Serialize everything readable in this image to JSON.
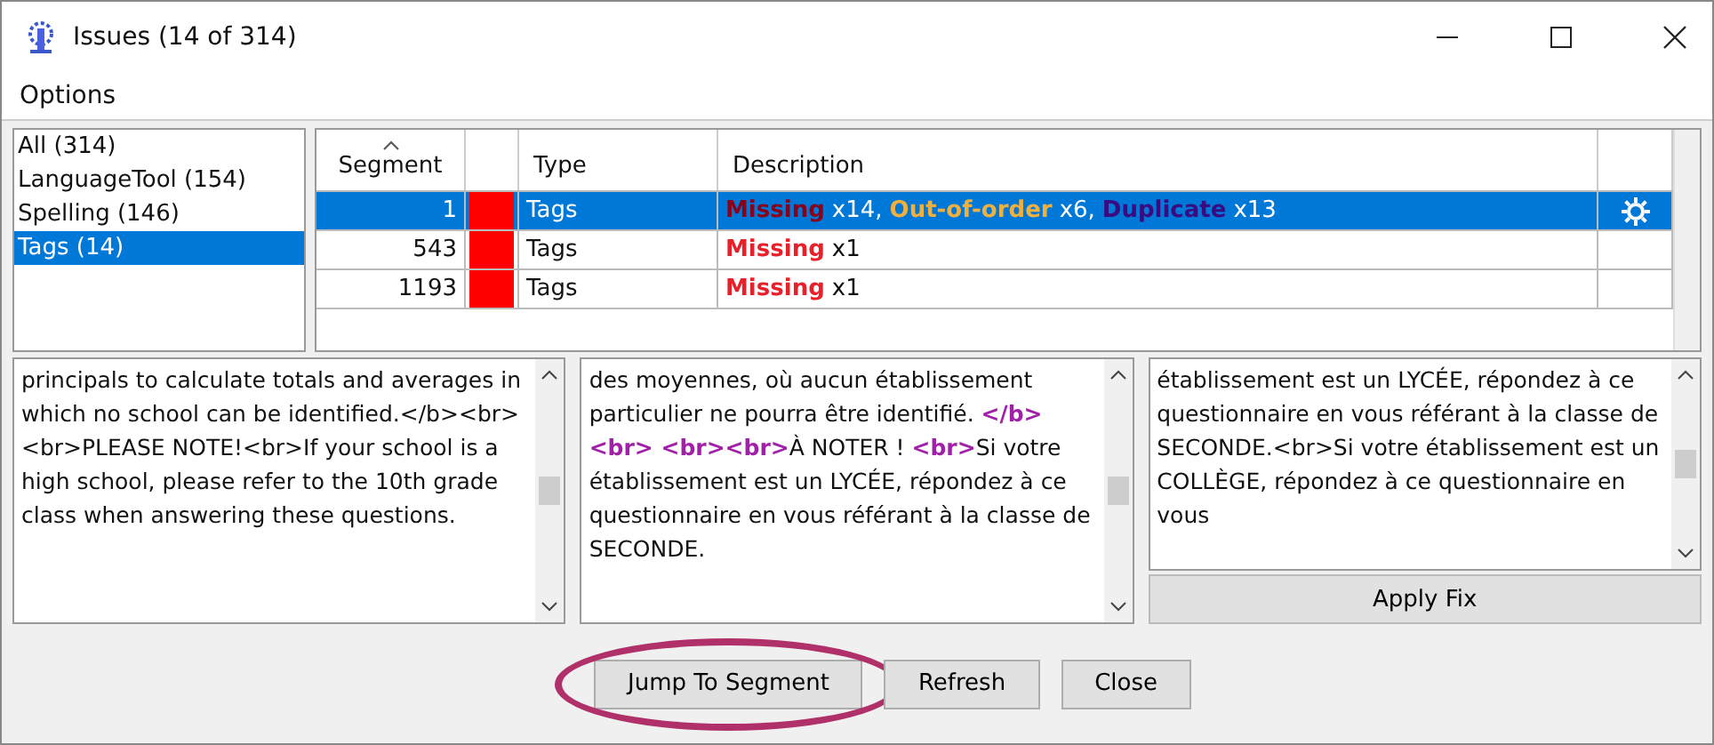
{
  "window": {
    "title": "Issues (14 of 314)"
  },
  "menu": [
    "Options"
  ],
  "categories": [
    {
      "label": "All (314)",
      "selected": false
    },
    {
      "label": "LanguageTool (154)",
      "selected": false
    },
    {
      "label": "Spelling (146)",
      "selected": false
    },
    {
      "label": "Tags (14)",
      "selected": true
    }
  ],
  "table": {
    "columns": [
      {
        "label": "Segment",
        "sorted": true
      },
      {
        "sorted": false
      },
      {
        "label": "Type",
        "sorted": false
      },
      {
        "label": "Description",
        "sorted": false
      }
    ],
    "rows": [
      {
        "segment": "1",
        "color": "#ff0000",
        "type": "Tags",
        "selected": true,
        "fixable": true,
        "description": [
          {
            "label": "Missing",
            "kind": "missing",
            "count": "x14,"
          },
          {
            "label": "Out-of-order",
            "kind": "order",
            "count": "x6,"
          },
          {
            "label": "Duplicate",
            "kind": "duplicate",
            "count": "x13"
          }
        ]
      },
      {
        "segment": "543",
        "color": "#ff0000",
        "type": "Tags",
        "selected": false,
        "fixable": false,
        "description": [
          {
            "label": "Missing",
            "kind": "missing",
            "count": "x1"
          }
        ]
      },
      {
        "segment": "1193",
        "color": "#ff0000",
        "type": "Tags",
        "selected": false,
        "fixable": false,
        "description": [
          {
            "label": "Missing",
            "kind": "missing",
            "count": "x1"
          }
        ]
      }
    ]
  },
  "panes": [
    {
      "segments": [
        {
          "kind": "text",
          "text": "principals to calculate totals and averages in which no school can be identified.</b><br><br>PLEASE NOTE!<br>If your school is a high school, please refer to the 10th grade class when answering these questions."
        }
      ]
    },
    {
      "segments": [
        {
          "kind": "text",
          "text": "des moyennes, où aucun établissement particulier ne pourra être identifié. "
        },
        {
          "kind": "tag",
          "text": "</b><br> <br><br>"
        },
        {
          "kind": "text",
          "text": "À NOTER ! "
        },
        {
          "kind": "tag",
          "text": "<br>"
        },
        {
          "kind": "text",
          "text": "Si votre établissement est un LYCÉE, répondez à ce questionnaire en vous référant à la classe de SECONDE."
        }
      ]
    },
    {
      "segments": [
        {
          "kind": "text",
          "text": "établissement est un LYCÉE, répondez à ce questionnaire en vous référant à la classe de SECONDE.<br>Si votre établissement est un COLLÈGE, répondez à ce questionnaire en vous"
        }
      ]
    }
  ],
  "apply_fix": "Apply Fix",
  "buttons": [
    {
      "label": "Jump To Segment",
      "highlighted": true
    },
    {
      "label": "Refresh",
      "highlighted": false
    },
    {
      "label": "Close",
      "highlighted": false
    }
  ]
}
